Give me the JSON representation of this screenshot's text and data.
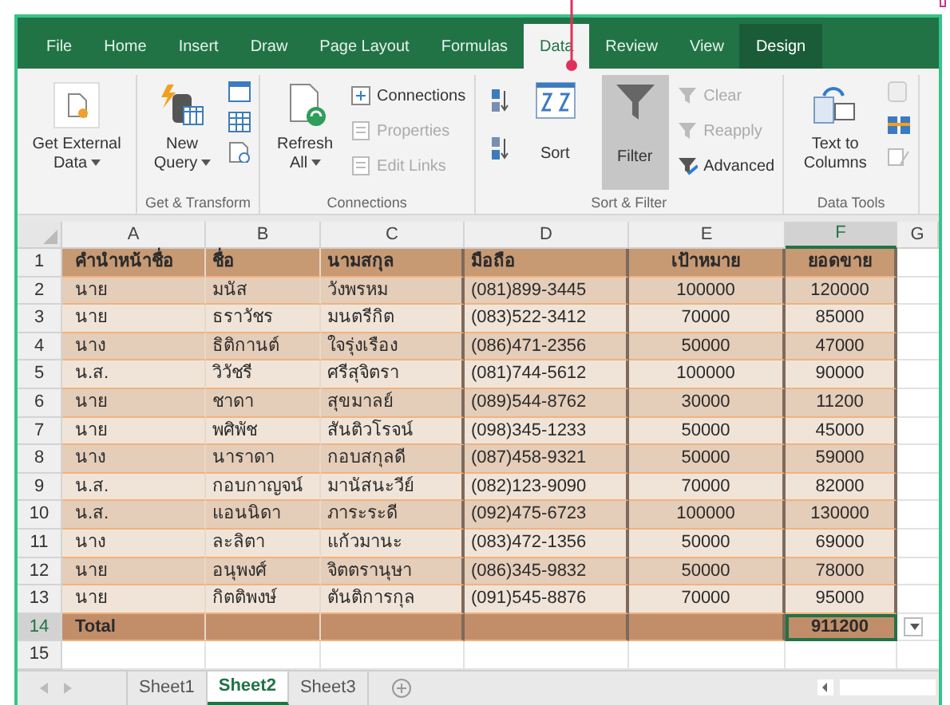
{
  "ribbon_tabs": [
    {
      "label": "File",
      "selected": false
    },
    {
      "label": "Home",
      "selected": false
    },
    {
      "label": "Insert",
      "selected": false
    },
    {
      "label": "Draw",
      "selected": false
    },
    {
      "label": "Page Layout",
      "selected": false
    },
    {
      "label": "Formulas",
      "selected": false
    },
    {
      "label": "Data",
      "selected": true
    },
    {
      "label": "Review",
      "selected": false
    },
    {
      "label": "View",
      "selected": false
    },
    {
      "label": "Design",
      "selected": false
    }
  ],
  "ribbon_groups": [
    {
      "items": [
        {
          "kind": "large",
          "label": "Get External Data",
          "dropdown": true,
          "selected": false,
          "disabled": false
        }
      ]
    },
    {
      "label": "Get & Transform",
      "items": [
        {
          "kind": "large",
          "label": "New Query",
          "dropdown": true,
          "selected": false,
          "disabled": false
        },
        {
          "kind": "icons"
        }
      ]
    },
    {
      "label": "Connections",
      "items": [
        {
          "kind": "large",
          "label": "Refresh All",
          "dropdown": true,
          "selected": false,
          "disabled": false
        },
        {
          "kind": "small",
          "label": "Connections",
          "disabled": false
        },
        {
          "kind": "small",
          "label": "Properties",
          "disabled": true
        },
        {
          "kind": "small",
          "label": "Edit Links",
          "disabled": true
        }
      ]
    },
    {
      "label": "Sort & Filter",
      "items": [
        {
          "kind": "icons"
        },
        {
          "kind": "large",
          "label": "Sort",
          "dropdown": false,
          "selected": false,
          "disabled": false
        },
        {
          "kind": "large",
          "label": "Filter",
          "dropdown": false,
          "selected": true,
          "disabled": false
        },
        {
          "kind": "small",
          "label": "Clear",
          "disabled": true
        },
        {
          "kind": "small",
          "label": "Reapply",
          "disabled": true
        },
        {
          "kind": "small",
          "label": "Advanced",
          "disabled": false
        }
      ]
    },
    {
      "label": "Data Tools",
      "items": [
        {
          "kind": "large",
          "label": "Text to Columns",
          "dropdown": false,
          "selected": false,
          "disabled": false
        },
        {
          "kind": "icons"
        }
      ]
    }
  ],
  "columns": [
    {
      "letter": "A",
      "selected": false
    },
    {
      "letter": "B",
      "selected": false
    },
    {
      "letter": "C",
      "selected": false
    },
    {
      "letter": "D",
      "selected": false
    },
    {
      "letter": "E",
      "selected": false
    },
    {
      "letter": "F",
      "selected": true
    },
    {
      "letter": "G",
      "selected": false
    }
  ],
  "rows": [
    {
      "number": "1",
      "kind": "header",
      "selected": false,
      "cells": [
        "คำนำหน้าชื่อ",
        "ชื่อ",
        "นามสกุล",
        "มือถือ",
        "เป้าหมาย",
        "ยอดขาย"
      ]
    },
    {
      "number": "2",
      "kind": "data",
      "selected": false,
      "cells": [
        "นาย",
        "มนัส",
        "วังพรหม",
        "(081)899-3445",
        "100000",
        "120000"
      ]
    },
    {
      "number": "3",
      "kind": "data",
      "selected": false,
      "cells": [
        "นาย",
        "ธราวัชร",
        "มนตรีกิต",
        "(083)522-3412",
        "70000",
        "85000"
      ]
    },
    {
      "number": "4",
      "kind": "data",
      "selected": false,
      "cells": [
        "นาง",
        "ธิติกานต์",
        "ใจรุ่งเรือง",
        "(086)471-2356",
        "50000",
        "47000"
      ]
    },
    {
      "number": "5",
      "kind": "data",
      "selected": false,
      "cells": [
        "น.ส.",
        "วิวัชรี",
        "ศรีสุจิตรา",
        "(081)744-5612",
        "100000",
        "90000"
      ]
    },
    {
      "number": "6",
      "kind": "data",
      "selected": false,
      "cells": [
        "นาย",
        "ชาดา",
        "สุขมาลย์",
        "(089)544-8762",
        "30000",
        "11200"
      ]
    },
    {
      "number": "7",
      "kind": "data",
      "selected": false,
      "cells": [
        "นาย",
        "พศิพัช",
        "สันติวโรจน์",
        "(098)345-1233",
        "50000",
        "45000"
      ]
    },
    {
      "number": "8",
      "kind": "data",
      "selected": false,
      "cells": [
        "นาง",
        "นาราดา",
        "กอบสกุลดี",
        "(087)458-9321",
        "50000",
        "59000"
      ]
    },
    {
      "number": "9",
      "kind": "data",
      "selected": false,
      "cells": [
        "น.ส.",
        "กอบกาญจน์",
        "มานัสนะวีย์",
        "(082)123-9090",
        "70000",
        "82000"
      ]
    },
    {
      "number": "10",
      "kind": "data",
      "selected": false,
      "cells": [
        "น.ส.",
        "แอนนิดา",
        "ภาระระดี",
        "(092)475-6723",
        "100000",
        "130000"
      ]
    },
    {
      "number": "11",
      "kind": "data",
      "selected": false,
      "cells": [
        "นาง",
        "ละลิตา",
        "แก้วมานะ",
        "(083)472-1356",
        "50000",
        "69000"
      ]
    },
    {
      "number": "12",
      "kind": "data",
      "selected": false,
      "cells": [
        "นาย",
        "อนุพงศ์",
        "จิตตรานุษา",
        "(086)345-9832",
        "50000",
        "78000"
      ]
    },
    {
      "number": "13",
      "kind": "data",
      "selected": false,
      "cells": [
        "นาย",
        "กิตติพงษ์",
        "ตันติการกุล",
        "(091)545-8876",
        "70000",
        "95000"
      ]
    },
    {
      "number": "14",
      "kind": "total",
      "selected": true,
      "label": "Total",
      "sum": "911200"
    },
    {
      "number": "15",
      "kind": "empty",
      "selected": false
    }
  ],
  "sheet_tabs": [
    {
      "label": "Sheet1",
      "selected": false
    },
    {
      "label": "Sheet2",
      "selected": true
    },
    {
      "label": "Sheet3",
      "selected": false
    }
  ]
}
